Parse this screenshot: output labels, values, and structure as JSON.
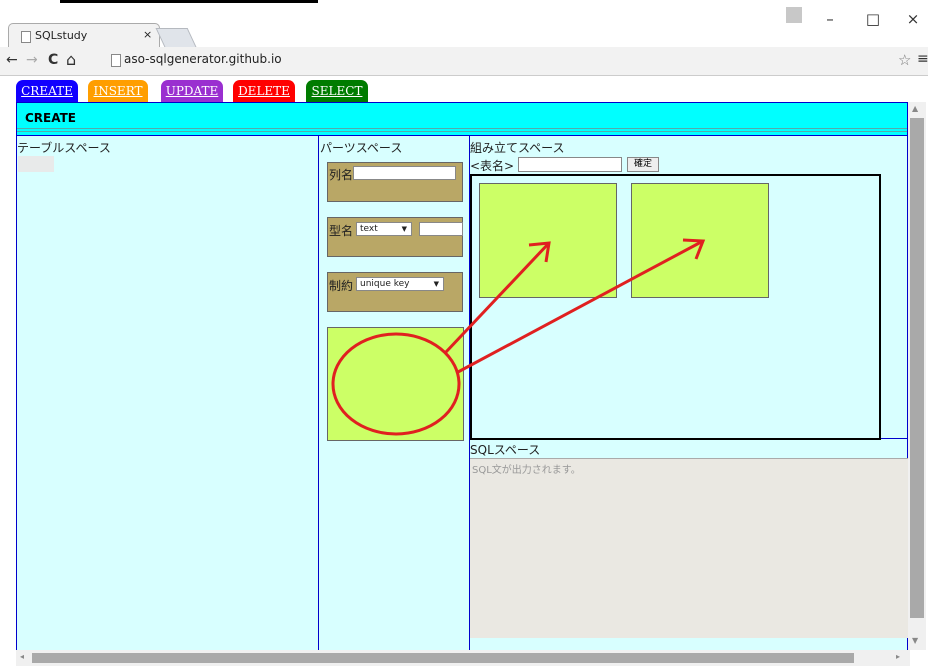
{
  "browser": {
    "tab_title": "SQLstudy",
    "tab_close": "×",
    "url": "aso-sqlgenerator.github.io",
    "win_minimize": "–",
    "win_maximize": "□",
    "win_close": "×",
    "nav_back": "←",
    "nav_forward": "→",
    "nav_reload": "C",
    "nav_home": "⌂",
    "star": "☆",
    "menu": "≡"
  },
  "nav": {
    "create": "CREATE",
    "insert": "INSERT",
    "update": "UPDATE",
    "delete": "DELETE",
    "select": "SELECT"
  },
  "heading": "CREATE",
  "sections": {
    "table_space": "テーブルスペース",
    "parts_space": "パーツスペース",
    "assembly_space": "組み立てスペース",
    "table_name_label": "<表名>",
    "confirm": "確定",
    "sql_space": "SQLスペース",
    "sql_placeholder": "SQL文が出力されます。"
  },
  "parts": {
    "column_name_label": "列名",
    "type_label": "型名",
    "type_selected": "text",
    "constraint_label": "制約",
    "constraint_selected": "unique key"
  },
  "colors": {
    "create": "#1100ff",
    "insert": "#ff9e00",
    "update": "#9a2fd0",
    "delete": "#ff0000",
    "select": "#007c00",
    "heading_bg": "#00ffff",
    "workspace_bg": "#d8ffff",
    "part_bg": "#b9a766",
    "green_box": "#ccff66",
    "annotation": "#e02020"
  }
}
